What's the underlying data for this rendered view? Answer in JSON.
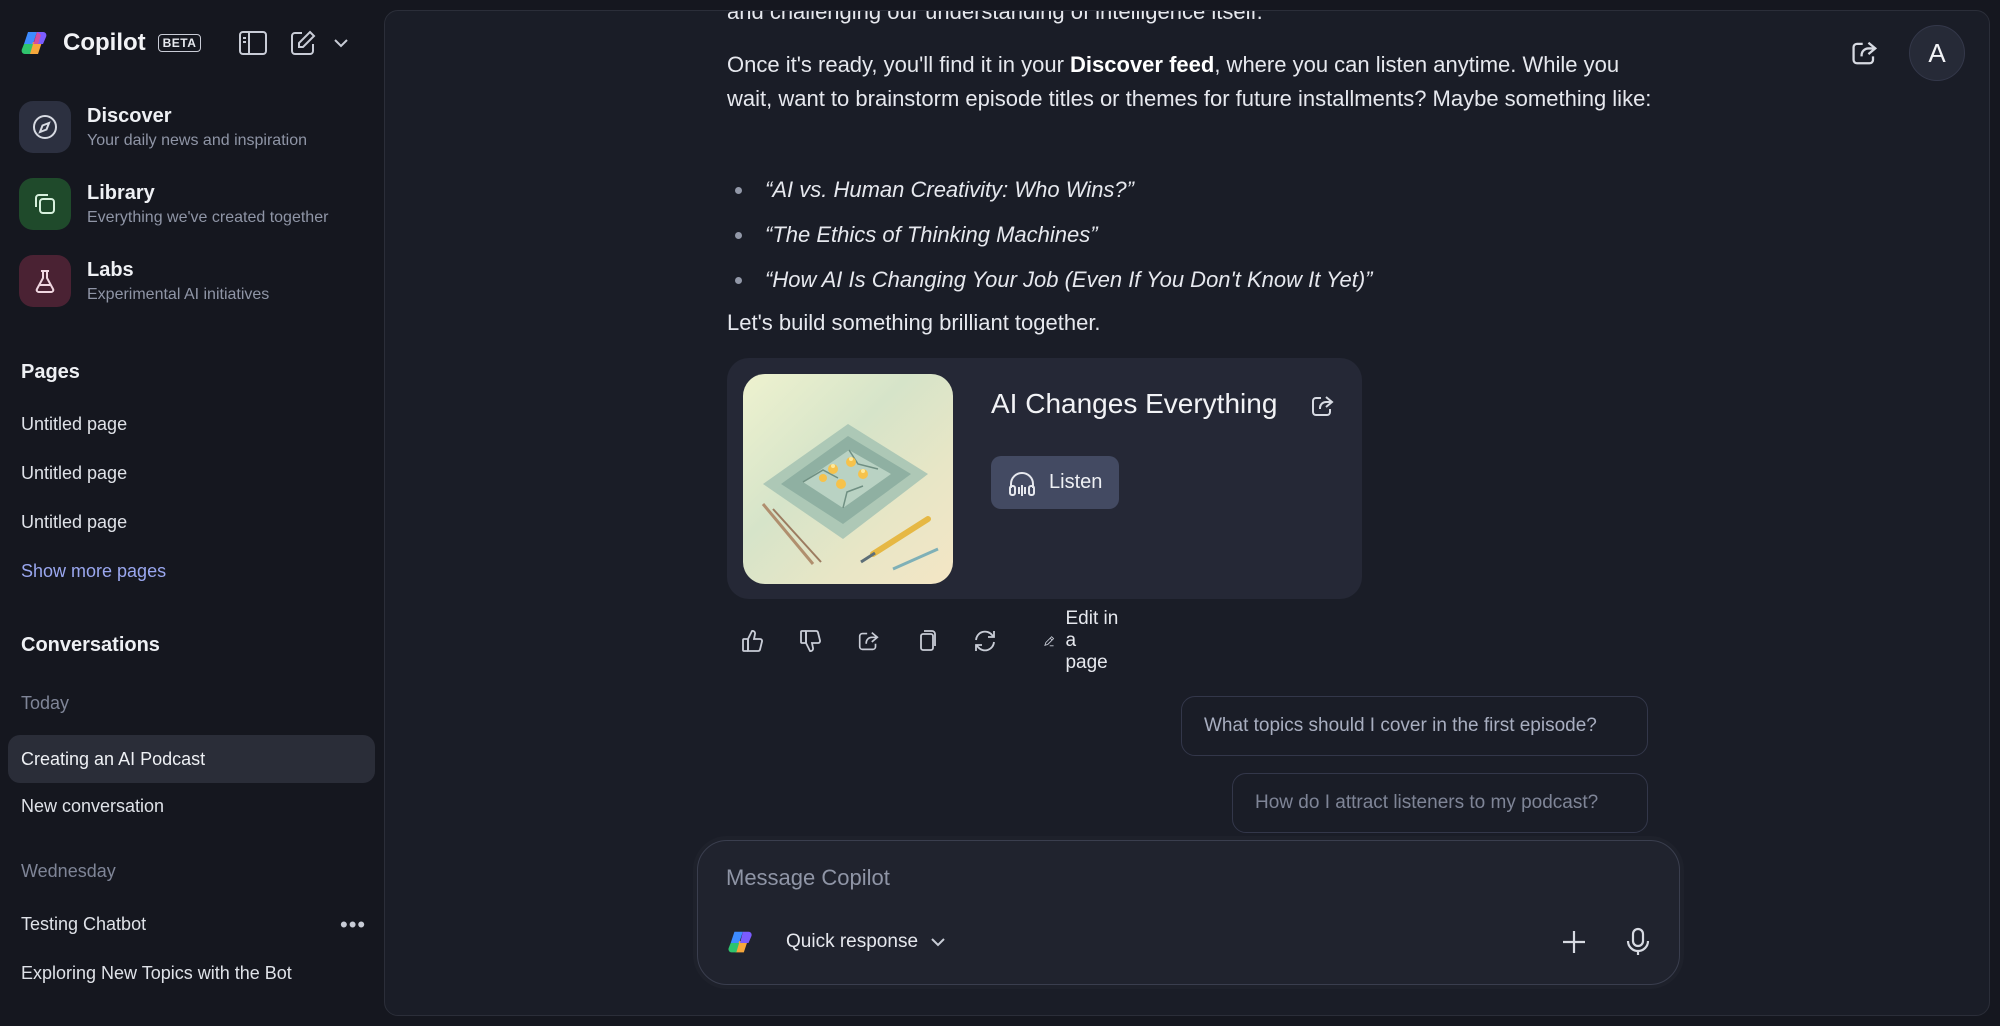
{
  "app": {
    "name": "Copilot",
    "badge": "BETA"
  },
  "nav": [
    {
      "title": "Discover",
      "subtitle": "Your daily news and inspiration",
      "icon": "compass-icon",
      "color": "#2c3040"
    },
    {
      "title": "Library",
      "subtitle": "Everything we've created together",
      "icon": "library-icon",
      "color": "#1f4a2b"
    },
    {
      "title": "Labs",
      "subtitle": "Experimental AI initiatives",
      "icon": "flask-icon",
      "color": "#4a2233"
    }
  ],
  "pages": {
    "heading": "Pages",
    "items": [
      "Untitled page",
      "Untitled page",
      "Untitled page"
    ],
    "show_more": "Show more pages"
  },
  "conversations": {
    "heading": "Conversations",
    "groups": [
      {
        "label": "Today",
        "items": [
          "Creating an AI Podcast",
          "New conversation"
        ]
      },
      {
        "label": "Wednesday",
        "items": [
          "Testing Chatbot",
          "Exploring New Topics with the Bot"
        ]
      }
    ]
  },
  "chat": {
    "cut_line": "and challenging our understanding of intelligence itself.",
    "para1_before": "Once it's ready, you'll find it in your ",
    "para1_bold": "Discover feed",
    "para1_after": ", where you can listen anytime. While you wait, want to brainstorm episode titles or themes for future installments? Maybe something like:",
    "bullets": [
      "“AI vs. Human Creativity: Who Wins?”",
      "“The Ethics of Thinking Machines”",
      "“How AI Is Changing Your Job (Even If You Don't Know It Yet)”"
    ],
    "closing": "Let's build something brilliant together.",
    "card": {
      "title": "AI Changes Everything",
      "listen_label": "Listen"
    },
    "edit_in_page": "Edit in a page",
    "suggestions": [
      "What topics should I cover in the first episode?",
      "How do I attract listeners to my podcast?"
    ]
  },
  "composer": {
    "placeholder": "Message Copilot",
    "mode": "Quick response"
  },
  "user": {
    "avatar_letter": "A"
  },
  "colors": {
    "background": "#15171f",
    "panel": "#1a1d27",
    "accent_link": "#9aa7ef"
  }
}
